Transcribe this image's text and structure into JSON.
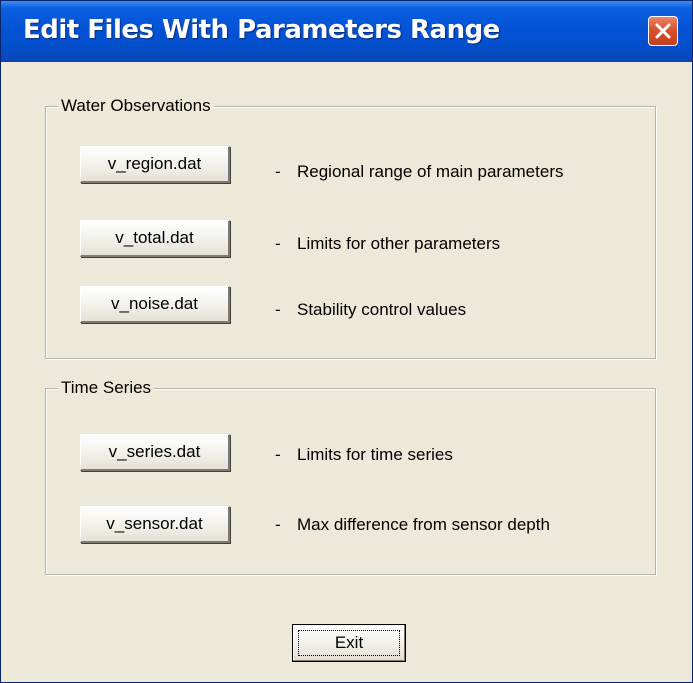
{
  "window": {
    "title": "Edit Files With Parameters Range"
  },
  "groups": {
    "water": {
      "label": "Water Observations",
      "items": [
        {
          "button": "v_region.dat",
          "description": "Regional range of main parameters"
        },
        {
          "button": "v_total.dat",
          "description": "Limits for other parameters"
        },
        {
          "button": "v_noise.dat",
          "description": "Stability control values"
        }
      ]
    },
    "time": {
      "label": "Time Series",
      "items": [
        {
          "button": "v_series.dat",
          "description": "Limits for time series"
        },
        {
          "button": "v_sensor.dat",
          "description": "Max difference from sensor depth"
        }
      ]
    }
  },
  "separator": "-",
  "exit_label": "Exit",
  "icons": {
    "close": "close-icon"
  },
  "colors": {
    "titlebar": "#0454d6",
    "close_button": "#d9532c",
    "dialog_background": "#ece9d8"
  }
}
